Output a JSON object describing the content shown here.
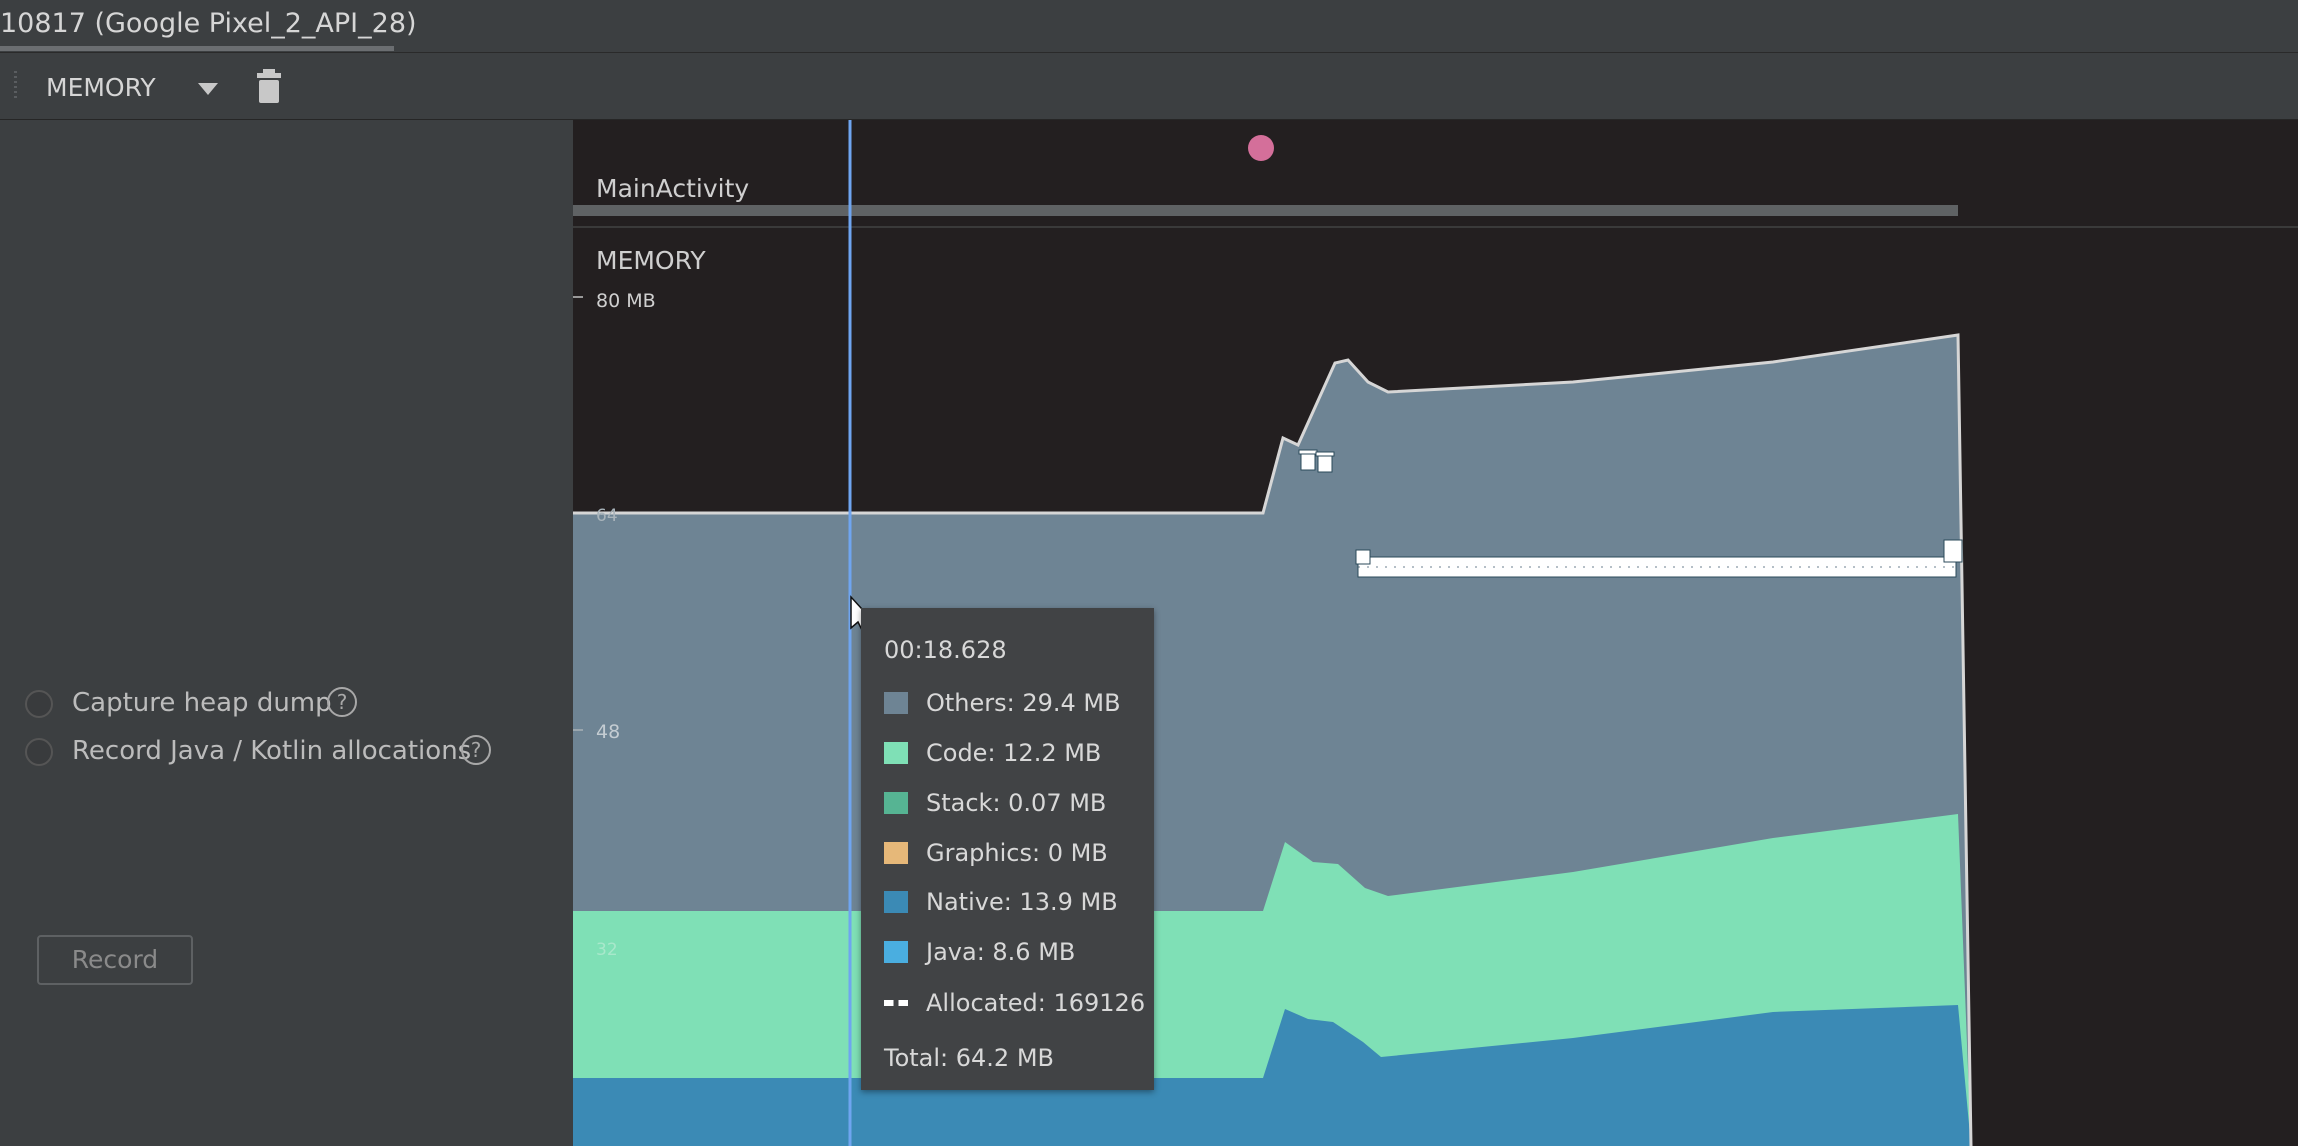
{
  "window": {
    "title": "10817 (Google Pixel_2_API_28)"
  },
  "toolbar": {
    "profiler_label": "MEMORY",
    "dropdown_icon": "triangle-down",
    "trash_icon": "trash"
  },
  "left_panel": {
    "options": [
      {
        "label": "Capture heap dump",
        "selected": false
      },
      {
        "label": "Record Java / Kotlin allocations",
        "selected": false
      }
    ],
    "help_glyph": "?",
    "record_button": "Record"
  },
  "timeline": {
    "activity_label": "MainActivity",
    "section_label": "MEMORY",
    "axis_labels": [
      "80 MB",
      "64",
      "48",
      "32"
    ],
    "colors": {
      "others": "#6e8494",
      "code": "#7fe0b6",
      "stack": "#56b493",
      "graphics": "#e6b879",
      "native": "#3b8ab5",
      "java": "#4aaee0",
      "allocated": "#ffffff",
      "cursor": "#6fa5f0",
      "event_dot": "#d46f9a"
    }
  },
  "tooltip": {
    "time": "00:18.628",
    "rows": [
      {
        "label": "Others: 29.4 MB",
        "color": "#6e8494",
        "kind": "box"
      },
      {
        "label": "Code: 12.2 MB",
        "color": "#7fe0b6",
        "kind": "box"
      },
      {
        "label": "Stack: 0.07 MB",
        "color": "#56b493",
        "kind": "box"
      },
      {
        "label": "Graphics: 0 MB",
        "color": "#e6b879",
        "kind": "box"
      },
      {
        "label": "Native: 13.9 MB",
        "color": "#3b8ab5",
        "kind": "box"
      },
      {
        "label": "Java: 8.6 MB",
        "color": "#4aaee0",
        "kind": "box"
      },
      {
        "label": "Allocated: 169126",
        "color": "#ffffff",
        "kind": "dash"
      }
    ],
    "total": "Total: 64.2 MB"
  }
}
